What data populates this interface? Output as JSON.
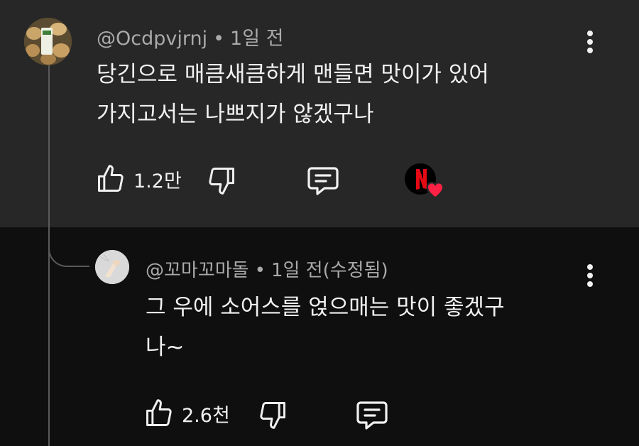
{
  "comments": [
    {
      "author": "@Ocdpvjrnj",
      "time": "1일 전",
      "lines": [
        "당긴으로 매큼새큼하게 맨들면 맛이가 있어",
        "가지고서는 나쁘지가 않겠구나"
      ],
      "likes": "1.2만",
      "icons": [
        "thumbs-up-icon",
        "thumbs-down-icon",
        "reply-icon",
        "creator-heart-icon"
      ]
    },
    {
      "author": "@꼬마꼬마돌",
      "time": "1일 전(수정됨)",
      "lines": [
        "그 우에 소어스를 얹으매는 맛이 좋겠구",
        "나~"
      ],
      "likes": "2.6천",
      "icons": [
        "thumbs-up-icon",
        "thumbs-down-icon",
        "reply-icon"
      ]
    }
  ],
  "colors": {
    "top_background": "#272727",
    "reply_background": "#0f0f0f",
    "text": "#f1f1f1",
    "meta": "#aaaaaa",
    "netflix_red": "#e50914",
    "heart_red": "#ff2244"
  }
}
